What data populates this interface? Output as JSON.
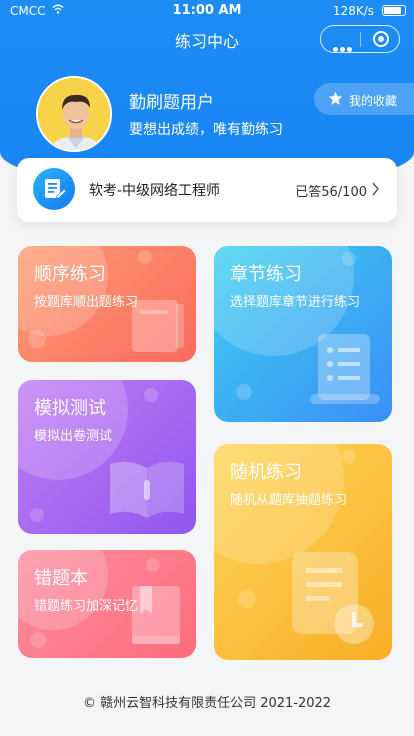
{
  "status_bar": {
    "carrier": "CMCC",
    "time": "11:00 AM",
    "speed": "128K/s"
  },
  "nav": {
    "title": "练习中心"
  },
  "user": {
    "name": "勤刷题用户",
    "motto": "要想出成绩，唯有勤练习"
  },
  "favorites": {
    "label": "我的收藏"
  },
  "course": {
    "name": "软考-中级网络工程师",
    "progress": "已答56/100"
  },
  "cards": [
    {
      "title": "顺序练习",
      "subtitle": "按题库顺出题练习",
      "icon": "book-icon"
    },
    {
      "title": "章节练习",
      "subtitle": "选择题库章节进行练习",
      "icon": "scroll-list-icon"
    },
    {
      "title": "模拟测试",
      "subtitle": "模拟出卷测试",
      "icon": "open-book-icon"
    },
    {
      "title": "随机练习",
      "subtitle": "随机从题库抽题练习",
      "icon": "document-clock-icon"
    },
    {
      "title": "错题本",
      "subtitle": "错题练习加深记忆",
      "icon": "bookmark-book-icon"
    }
  ],
  "footer": {
    "copyright": "© 赣州云智科技有限责任公司 2021-2022"
  },
  "colors": {
    "primary": "#1786f3",
    "c1": "#f86a5f",
    "c2": "#3b8ef6",
    "c3": "#8f58ee",
    "c4": "#f7ae25",
    "c5": "#fb6c7c"
  }
}
